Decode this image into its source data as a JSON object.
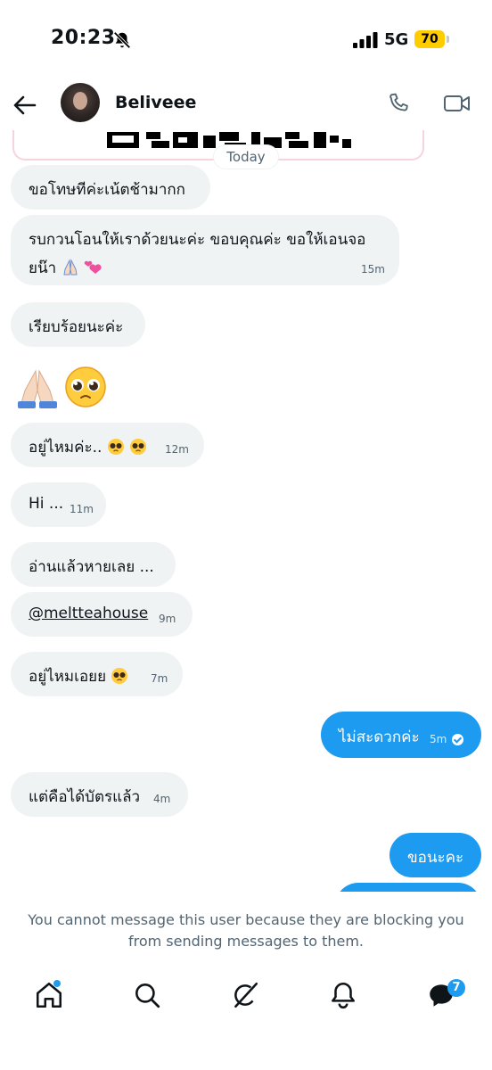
{
  "status_bar": {
    "time": "20:23",
    "network": "5G",
    "battery": "70"
  },
  "header": {
    "contact_name": "Beliveee"
  },
  "date_divider": "Today",
  "messages": [
    {
      "text": "ขอโทษทีค่ะเน้ตช้ามากก",
      "time": "",
      "direction": "incoming"
    },
    {
      "text_line1": "รบกวนโอนให้เราด้วยนะค่ะ ขอบคุณค่ะ ขอให้เอนจอ",
      "text_line2": "ยน๊า",
      "time": "15m",
      "direction": "incoming"
    },
    {
      "text": "เรียบร้อยนะค่ะ",
      "time": "",
      "direction": "incoming"
    },
    {
      "text": "อยู่ไหมค่ะ..",
      "time": "12m",
      "direction": "incoming"
    },
    {
      "text": "Hi ...",
      "time": "11m",
      "direction": "incoming"
    },
    {
      "text": "อ่านแล้วหายเลย ...",
      "time": "",
      "direction": "incoming"
    },
    {
      "text": "@meltteahouse",
      "time": "9m",
      "direction": "incoming"
    },
    {
      "text": "อยู่ไหมเอยย",
      "time": "7m",
      "direction": "incoming"
    },
    {
      "text": "ไม่สะดวกค่ะ",
      "time": "5m",
      "direction": "outgoing"
    },
    {
      "text": "แต่คือได้บัตรแล้ว",
      "time": "4m",
      "direction": "incoming"
    },
    {
      "text": "ขอนะคะ",
      "time": "",
      "direction": "outgoing"
    }
  ],
  "blocked_notice_line1": "You cannot message this user because they are blocking you",
  "blocked_notice_line2": "from sending messages to them.",
  "tabbar": {
    "messages_badge": "7"
  },
  "colors": {
    "accent": "#1d9bf0",
    "bubble_incoming": "#eff3f4",
    "battery": "#ffcc00"
  }
}
